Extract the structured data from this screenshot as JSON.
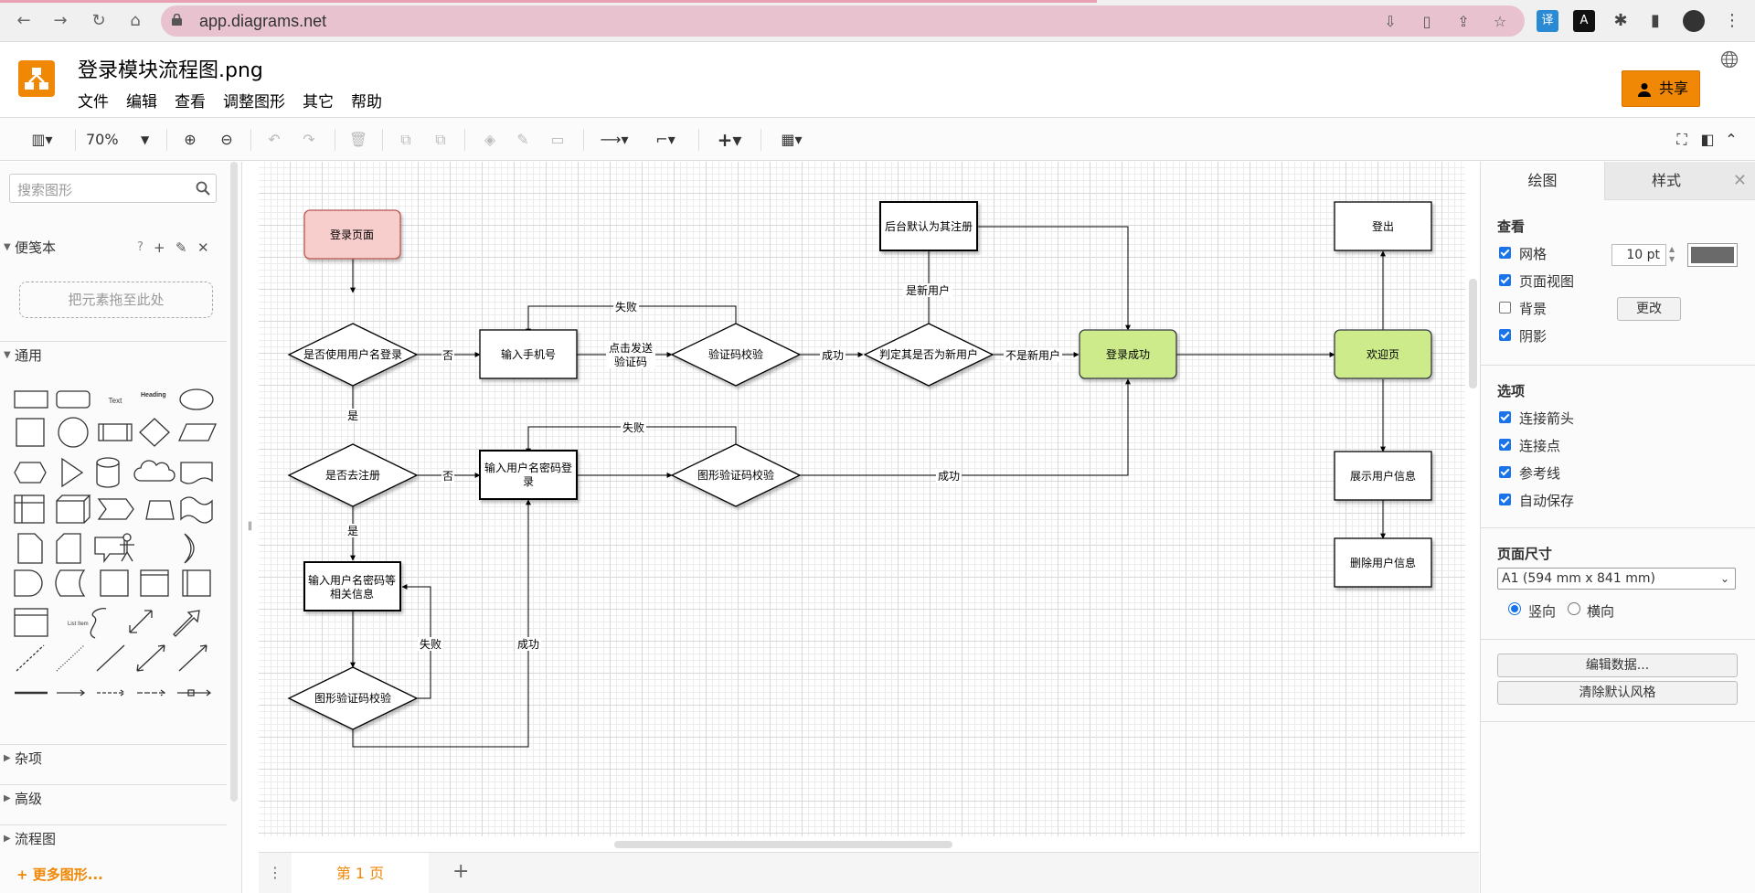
{
  "browser": {
    "url": "app.diagrams.net"
  },
  "app": {
    "file_title": "登录模块流程图.png",
    "menu": [
      "文件",
      "编辑",
      "查看",
      "调整图形",
      "其它",
      "帮助"
    ],
    "share_label": "共享",
    "brand_color": "#f08705"
  },
  "toolbar": {
    "zoom": "70%"
  },
  "sidebar": {
    "search_placeholder": "搜索图形",
    "scratchpad_title": "便笺本",
    "scratchpad_tools": [
      "?",
      "+",
      "✎",
      "✕"
    ],
    "scratchpad_drop": "把元素拖至此处",
    "general_title": "通用",
    "shape_text_label": "Text",
    "shape_heading_label": "Heading",
    "shape_list_item_label": "List Item",
    "sections": [
      "杂项",
      "高级",
      "流程图"
    ],
    "more_shapes": "+ 更多图形..."
  },
  "pages": {
    "current": "第 1 页"
  },
  "diagram": {
    "nodes": {
      "login_page": "登录页面",
      "use_username": "是否使用用户名登录",
      "input_phone": "输入手机号",
      "verify_code": "验证码校验",
      "is_new_user": "判定其是否为新用户",
      "backend_register": "后台默认为其注册",
      "login_success": "登录成功",
      "welcome": "欢迎页",
      "logout": "登出",
      "show_user": "展示用户信息",
      "delete_user": "删除用户信息",
      "go_register": "是否去注册",
      "input_user_pwd_login_line1": "输入用户名密码登",
      "input_user_pwd_login_line2": "录",
      "captcha_check": "图形验证码校验",
      "input_reg_info_line1": "输入用户名密码等",
      "input_reg_info_line2": "相关信息",
      "captcha_check2": "图形验证码校验"
    },
    "edge_labels": {
      "no1": "否",
      "send_code_line1": "点击发送",
      "send_code_line2": "验证码",
      "fail1": "失败",
      "success1": "成功",
      "not_new_user": "不是新用户",
      "is_new_user": "是新用户",
      "yes1": "是",
      "no2": "否",
      "fail2": "失败",
      "success2": "成功",
      "yes2": "是",
      "fail3": "失败",
      "success3": "成功"
    },
    "colors": {
      "login_page_fill": "#f8cecc",
      "login_page_stroke": "#b85450",
      "success_fill": "#cdeb8b",
      "success_stroke": "#36393d"
    }
  },
  "right_panel": {
    "tabs": [
      "绘图",
      "样式"
    ],
    "view_title": "查看",
    "view_options": [
      {
        "label": "网格",
        "checked": true
      },
      {
        "label": "页面视图",
        "checked": true
      },
      {
        "label": "背景",
        "checked": false
      },
      {
        "label": "阴影",
        "checked": true
      }
    ],
    "grid_size": "10 pt",
    "grid_color": "#6a6a6a",
    "change_button": "更改",
    "options_title": "选项",
    "options": [
      {
        "label": "连接箭头",
        "checked": true
      },
      {
        "label": "连接点",
        "checked": true
      },
      {
        "label": "参考线",
        "checked": true
      },
      {
        "label": "自动保存",
        "checked": true
      }
    ],
    "page_size_title": "页面尺寸",
    "page_size_value": "A1 (594 mm x 841 mm)",
    "orientation_portrait": "竖向",
    "orientation_landscape": "横向",
    "edit_data_button": "编辑数据...",
    "clear_style_button": "清除默认风格"
  }
}
